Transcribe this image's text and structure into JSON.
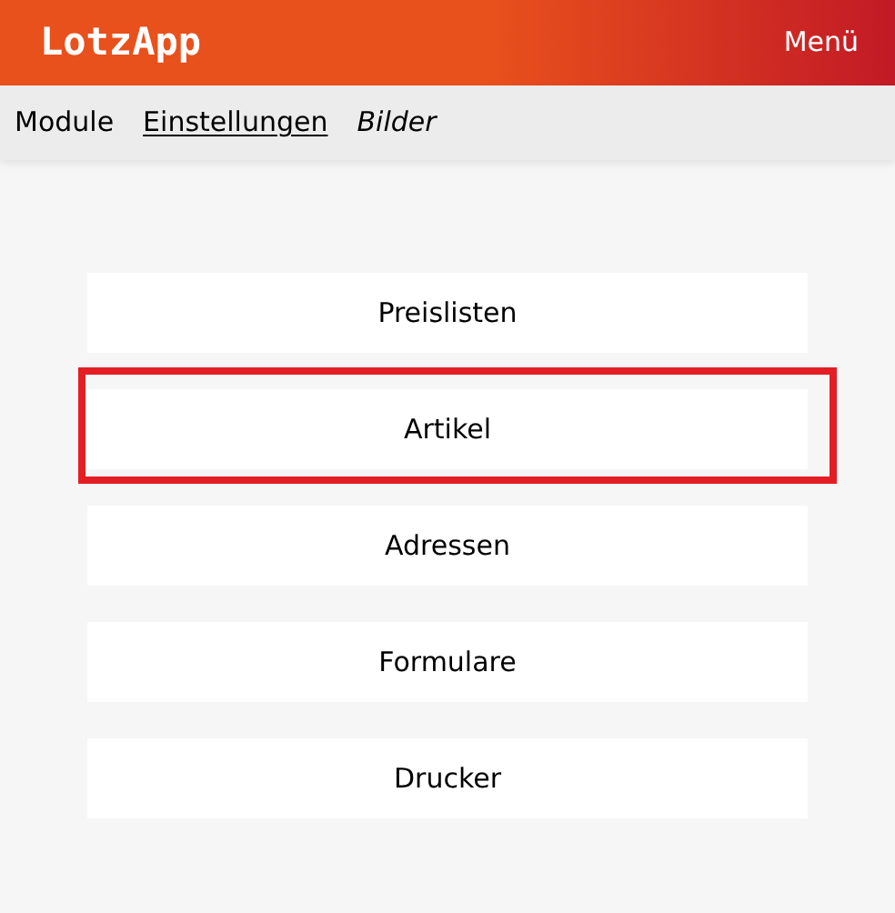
{
  "header": {
    "title": "LotzApp",
    "menu": "Menü"
  },
  "nav": [
    {
      "label": "Module",
      "selected": false,
      "kind": "plain"
    },
    {
      "label": "Einstellungen",
      "selected": true,
      "kind": "plain"
    },
    {
      "label": "Bilder",
      "selected": false,
      "kind": "italic"
    }
  ],
  "items": [
    {
      "label": "Preislisten",
      "highlighted": false
    },
    {
      "label": "Artikel",
      "highlighted": true
    },
    {
      "label": "Adressen",
      "highlighted": false
    },
    {
      "label": "Formulare",
      "highlighted": false
    },
    {
      "label": "Drucker",
      "highlighted": false
    }
  ]
}
